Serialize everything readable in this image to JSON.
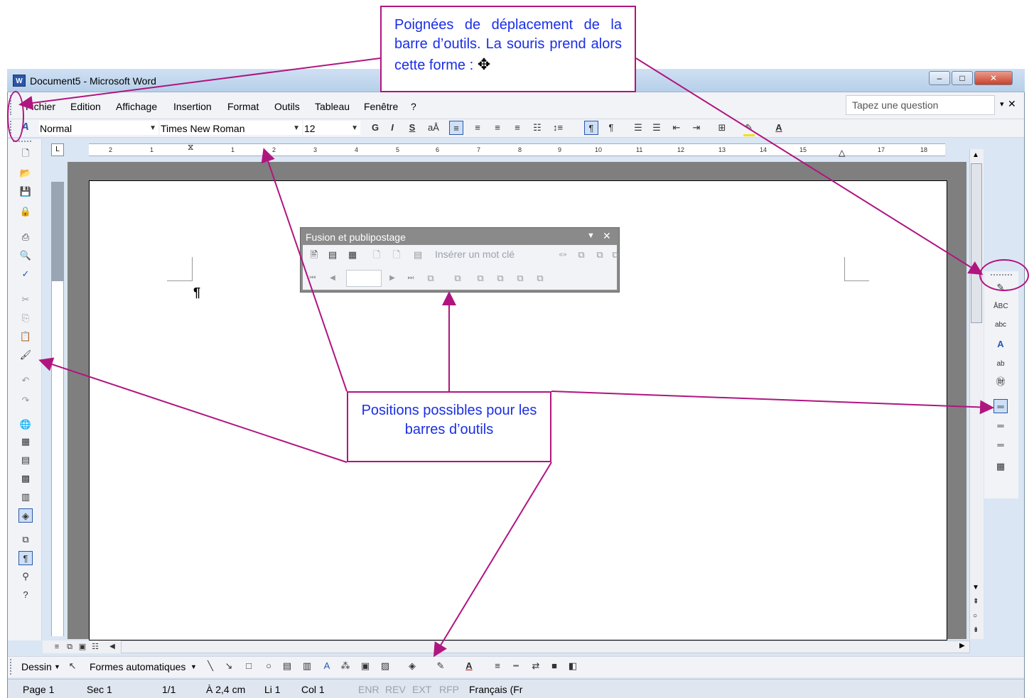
{
  "window": {
    "title": "Document5 - Microsoft Word",
    "app_icon": "word-doc-icon"
  },
  "menu": {
    "items": [
      "Fichier",
      "Edition",
      "Affichage",
      "Insertion",
      "Format",
      "Outils",
      "Tableau",
      "Fenêtre",
      "?"
    ],
    "ask_placeholder": "Tapez une question"
  },
  "formatting": {
    "style": "Normal",
    "font": "Times New Roman",
    "size": "12",
    "bold_label": "G",
    "italic_label": "I",
    "underline_label": "S"
  },
  "ruler": {
    "ticks": [
      "2",
      "1",
      "1",
      "2",
      "3",
      "4",
      "5",
      "6",
      "7",
      "8",
      "9",
      "10",
      "11",
      "12",
      "13",
      "14",
      "15",
      "17",
      "18"
    ]
  },
  "mail_merge_toolbar": {
    "title": "Fusion et publipostage",
    "insert_keyword": "Insérer un mot clé",
    "record_value": ""
  },
  "drawing": {
    "draw_menu": "Dessin",
    "autoshapes": "Formes automatiques"
  },
  "status": {
    "page": "Page 1",
    "section": "Sec 1",
    "pages": "1/1",
    "position": "À 2,4 cm",
    "line": "Li 1",
    "column": "Col 1",
    "enr": "ENR",
    "rev": "REV",
    "ext": "EXT",
    "rfp": "RFP",
    "language": "Français (Fr"
  },
  "callouts": {
    "top": "Poignées de déplacement de la barre d’outils. La souris prend alors cette forme :",
    "middle": "Positions possibles pour les barres d’outils",
    "accent_color": "#b0157f",
    "text_color": "#1a2ee6"
  }
}
